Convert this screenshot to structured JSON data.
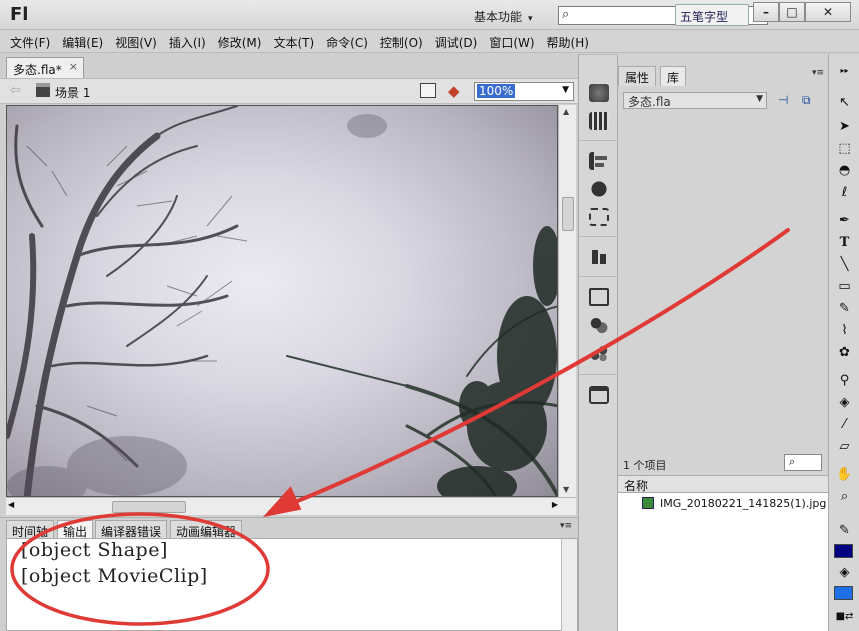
{
  "app": {
    "logo": "Fl",
    "workspace": "基本功能",
    "ime": "五笔字型"
  },
  "menu": [
    "文件(F)",
    "编辑(E)",
    "视图(V)",
    "插入(I)",
    "修改(M)",
    "文本(T)",
    "命令(C)",
    "控制(O)",
    "调试(D)",
    "窗口(W)",
    "帮助(H)"
  ],
  "document": {
    "tab": "多态.fla*",
    "scene": "场景 1",
    "zoom": "100%"
  },
  "bottom_tabs": [
    "时间轴",
    "输出",
    "编译器错误",
    "动画编辑器"
  ],
  "output": [
    "[object Shape]",
    "[object MovieClip]"
  ],
  "library": {
    "tabs": [
      "属性",
      "库"
    ],
    "file": "多态.fla",
    "count": "1 个项目",
    "column": "名称",
    "items": [
      "IMG_20180221_141825(1).jpg"
    ]
  },
  "colors": {
    "stroke": "#000080",
    "fill": "#1e6fe6",
    "annotation": "#e03a36"
  }
}
